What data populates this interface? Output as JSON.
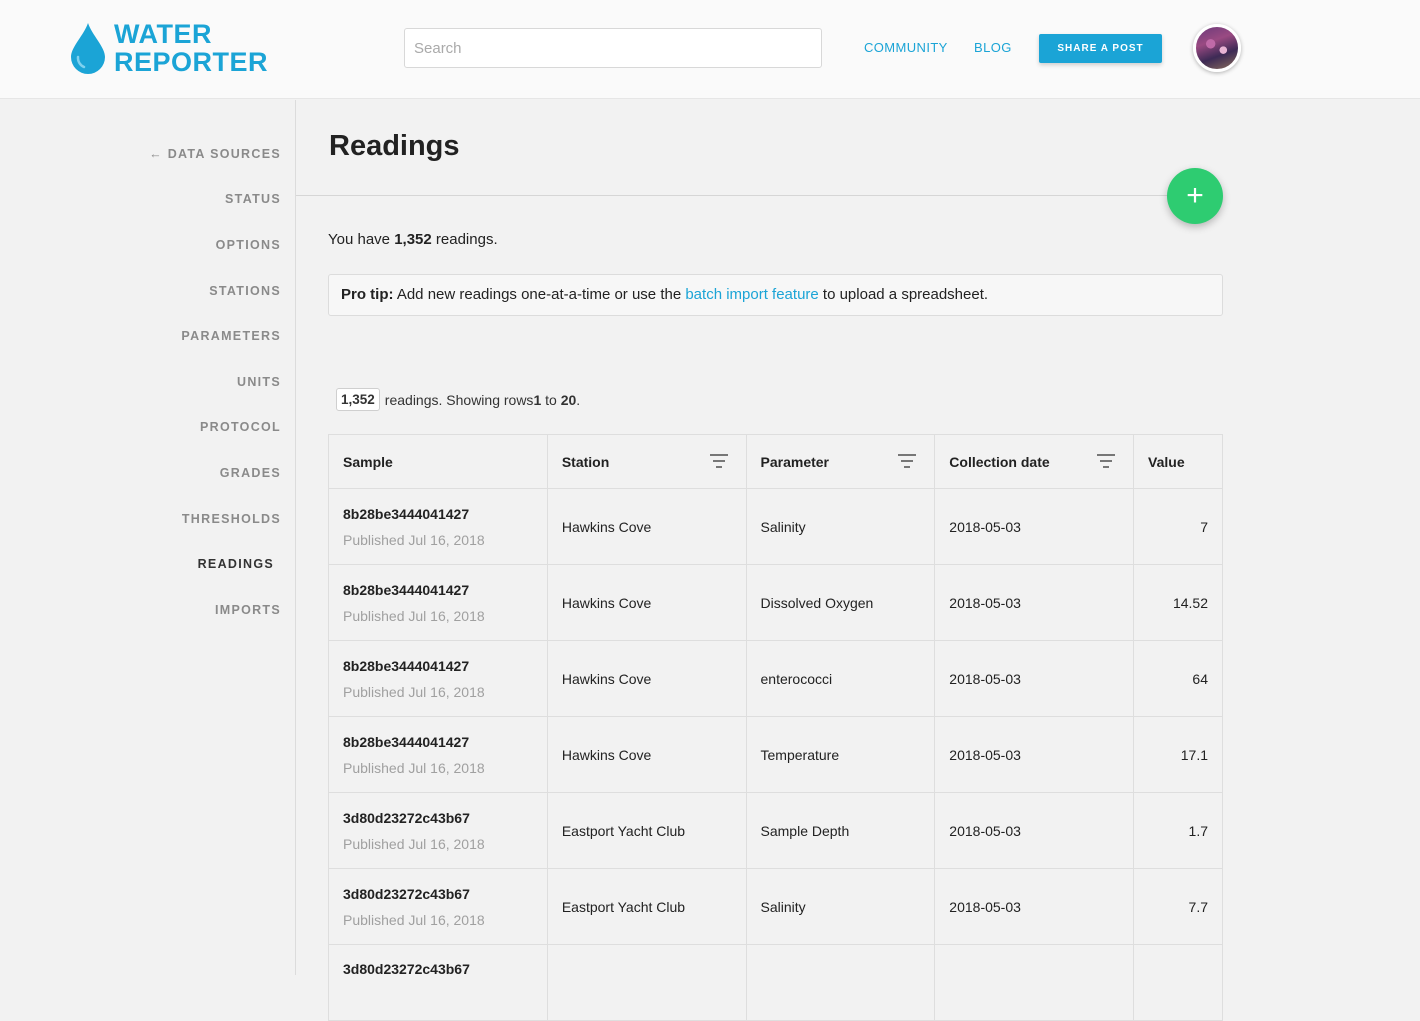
{
  "header": {
    "logo_line1": "WATER",
    "logo_line2": "REPORTER",
    "search_placeholder": "Search",
    "search_value": "",
    "nav": {
      "community": "COMMUNITY",
      "blog": "BLOG"
    },
    "share_button": "SHARE A POST",
    "brand_color": "#1ba4d6"
  },
  "sidebar": {
    "items": [
      {
        "label": "← DATA SOURCES"
      },
      {
        "label": "STATUS"
      },
      {
        "label": "OPTIONS"
      },
      {
        "label": "STATIONS"
      },
      {
        "label": "PARAMETERS"
      },
      {
        "label": "UNITS"
      },
      {
        "label": "PROTOCOL"
      },
      {
        "label": "GRADES"
      },
      {
        "label": "THRESHOLDS"
      },
      {
        "label": "READINGS",
        "active": true
      },
      {
        "label": "IMPORTS"
      }
    ]
  },
  "main": {
    "title": "Readings",
    "add_button": "+",
    "summary_prefix": "You have ",
    "summary_count": "1,352",
    "summary_suffix": " readings.",
    "tip": {
      "label": "Pro tip:",
      "text_before": " Add new readings one-at-a-time or use the ",
      "link": "batch import feature",
      "text_after": " to upload a spreadsheet."
    },
    "count_badge": "1,352",
    "count_text1": "readings. Showing rows ",
    "row_from": "1",
    "count_text2": " to ",
    "row_to": "20",
    "count_text3": "."
  },
  "table": {
    "headers": [
      "Sample",
      "Station",
      "Parameter",
      "Collection date",
      "Value"
    ],
    "rows": [
      {
        "sample": "8b28be3444041427",
        "published": "Published Jul 16, 2018",
        "station": "Hawkins Cove",
        "parameter": "Salinity",
        "date": "2018-05-03",
        "value": "7"
      },
      {
        "sample": "8b28be3444041427",
        "published": "Published Jul 16, 2018",
        "station": "Hawkins Cove",
        "parameter": "Dissolved Oxygen",
        "date": "2018-05-03",
        "value": "14.52"
      },
      {
        "sample": "8b28be3444041427",
        "published": "Published Jul 16, 2018",
        "station": "Hawkins Cove",
        "parameter": "enterococci",
        "date": "2018-05-03",
        "value": "64"
      },
      {
        "sample": "8b28be3444041427",
        "published": "Published Jul 16, 2018",
        "station": "Hawkins Cove",
        "parameter": "Temperature",
        "date": "2018-05-03",
        "value": "17.1"
      },
      {
        "sample": "3d80d23272c43b67",
        "published": "Published Jul 16, 2018",
        "station": "Eastport Yacht Club",
        "parameter": "Sample Depth",
        "date": "2018-05-03",
        "value": "1.7"
      },
      {
        "sample": "3d80d23272c43b67",
        "published": "Published Jul 16, 2018",
        "station": "Eastport Yacht Club",
        "parameter": "Salinity",
        "date": "2018-05-03",
        "value": "7.7"
      },
      {
        "sample": "3d80d23272c43b67",
        "published": "",
        "station": "",
        "parameter": "",
        "date": "",
        "value": ""
      }
    ]
  },
  "colors": {
    "accent": "#1ba4d6",
    "fab": "#2ecc71"
  }
}
